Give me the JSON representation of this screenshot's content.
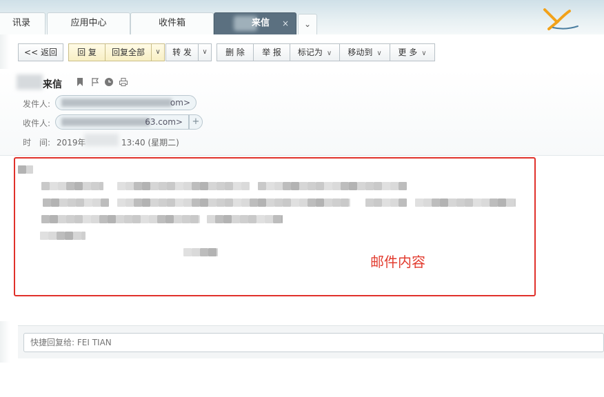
{
  "tabs": [
    {
      "label": "讯录"
    },
    {
      "label": "应用中心"
    },
    {
      "label": "收件箱"
    },
    {
      "label": "来信",
      "close": "×"
    }
  ],
  "tab_more": "⌄",
  "toolbar": {
    "back": "<< 返回",
    "reply": "回 复",
    "reply_all": "回复全部",
    "forward": "转 发",
    "delete": "删 除",
    "report": "举 报",
    "mark_as": "标记为",
    "move_to": "移动到",
    "more": "更 多"
  },
  "mail": {
    "subject": "来信",
    "from_label": "发件人:",
    "from_tail": "om>",
    "to_label": "收件人:",
    "to_tail": "63.com>",
    "time_label": "时　间:",
    "time_prefix": "2019年",
    "time_suffix": "13:40 (星期二)",
    "add_recipient": "+"
  },
  "content_annotation": "邮件内容",
  "quick_reply": {
    "placeholder": "快捷回复给: FEI TIAN"
  },
  "colors": {
    "annotation_red": "#e0302a",
    "active_tab": "#5b7080",
    "reply_button_yellow": "#f8efc4"
  }
}
